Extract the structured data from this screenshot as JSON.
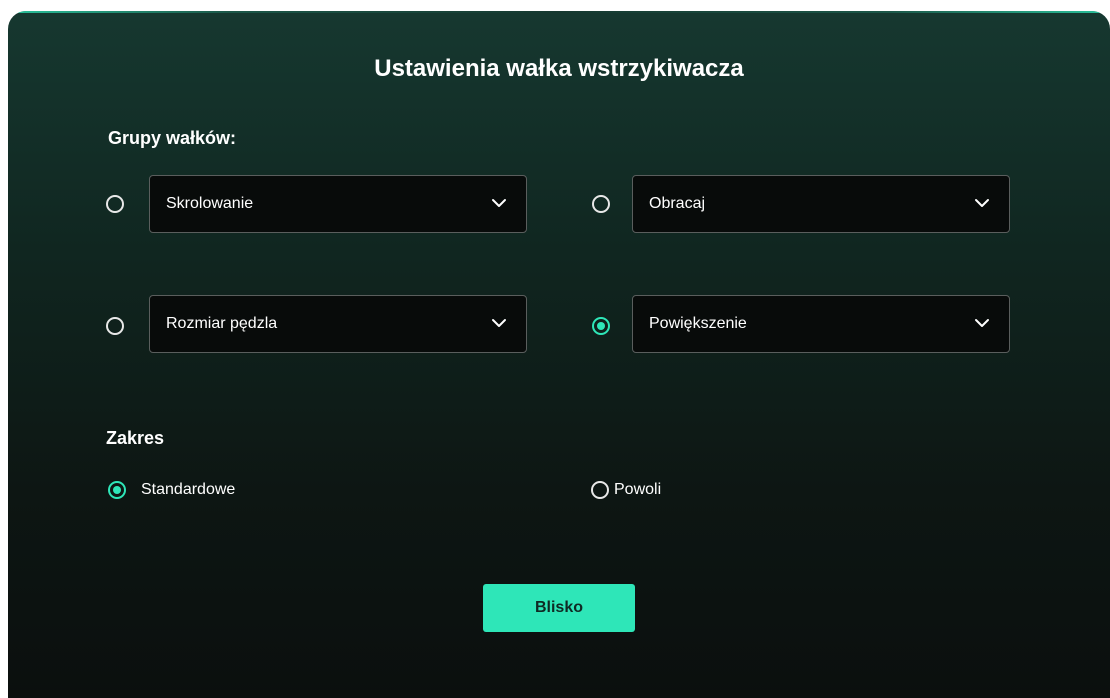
{
  "dialog": {
    "title": "Ustawienia wałka wstrzykiwacza"
  },
  "groups": {
    "label": "Grupy wałków:",
    "items": [
      {
        "value": "Skrolowanie",
        "selected": false
      },
      {
        "value": "Obracaj",
        "selected": false
      },
      {
        "value": "Rozmiar pędzla",
        "selected": false
      },
      {
        "value": "Powiększenie",
        "selected": true
      }
    ]
  },
  "range": {
    "label": "Zakres",
    "options": [
      {
        "label": "Standardowe",
        "selected": true
      },
      {
        "label": "Powoli",
        "selected": false
      }
    ]
  },
  "footer": {
    "close_label": "Blisko"
  },
  "colors": {
    "accent": "#2ee6b8",
    "background_top": "#163830",
    "background_bottom": "#0b0f0e",
    "select_background": "#080b0a"
  },
  "icons": {
    "select_arrow": "chevron-down-icon"
  }
}
